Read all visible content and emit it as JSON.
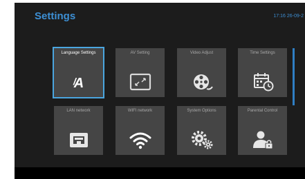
{
  "screen": {
    "title": "Settings",
    "clock": "17:16 26-09-2"
  },
  "tiles": [
    {
      "label": "Language Settings",
      "icon": "language-icon",
      "selected": true
    },
    {
      "label": "AV Setting",
      "icon": "screen-resize-icon"
    },
    {
      "label": "Video Adjust",
      "icon": "film-reel-icon"
    },
    {
      "label": "Time Settings",
      "icon": "calendar-clock-icon"
    },
    {
      "label": "LAN network",
      "icon": "ethernet-port-icon"
    },
    {
      "label": "WIFI network",
      "icon": "wifi-icon"
    },
    {
      "label": "System Options",
      "icon": "gears-icon"
    },
    {
      "label": "Parental Control",
      "icon": "user-lock-icon"
    }
  ],
  "colors": {
    "accent": "#3d8fd4",
    "selection": "#4aa6e0",
    "tile": "#454545",
    "panel": "#1c1c1c"
  }
}
